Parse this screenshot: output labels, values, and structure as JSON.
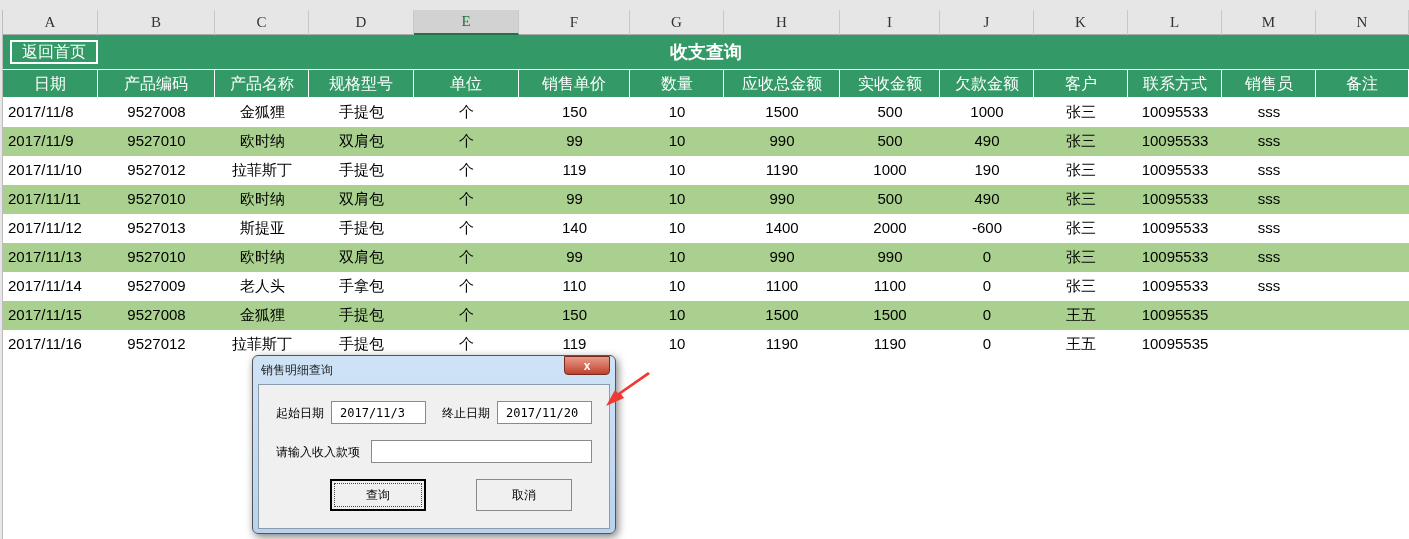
{
  "column_headers": [
    {
      "label": "A",
      "selected": false
    },
    {
      "label": "B",
      "selected": false
    },
    {
      "label": "C",
      "selected": false
    },
    {
      "label": "D",
      "selected": false
    },
    {
      "label": "E",
      "selected": true
    },
    {
      "label": "F",
      "selected": false
    },
    {
      "label": "G",
      "selected": false
    },
    {
      "label": "H",
      "selected": false
    },
    {
      "label": "I",
      "selected": false
    },
    {
      "label": "J",
      "selected": false
    },
    {
      "label": "K",
      "selected": false
    },
    {
      "label": "L",
      "selected": false
    },
    {
      "label": "M",
      "selected": false
    },
    {
      "label": "N",
      "selected": false
    }
  ],
  "home_button": "返回首页",
  "sheet_title": "收支查询",
  "table": {
    "columns": [
      "日期",
      "产品编码",
      "产品名称",
      "规格型号",
      "单位",
      "销售单价",
      "数量",
      "应收总金额",
      "实收金额",
      "欠款金额",
      "客户",
      "联系方式",
      "销售员",
      "备注"
    ],
    "rows": [
      {
        "cells": [
          "2017/11/8",
          "9527008",
          "金狐狸",
          "手提包",
          "个",
          "150",
          "10",
          "1500",
          "500",
          "1000",
          "张三",
          "10095533",
          "sss"
        ]
      },
      {
        "cells": [
          "2017/11/9",
          "9527010",
          "欧时纳",
          "双肩包",
          "个",
          "99",
          "10",
          "990",
          "500",
          "490",
          "张三",
          "10095533",
          "sss"
        ]
      },
      {
        "cells": [
          "2017/11/10",
          "9527012",
          "拉菲斯丁",
          "手提包",
          "个",
          "119",
          "10",
          "1190",
          "1000",
          "190",
          "张三",
          "10095533",
          "sss"
        ]
      },
      {
        "cells": [
          "2017/11/11",
          "9527010",
          "欧时纳",
          "双肩包",
          "个",
          "99",
          "10",
          "990",
          "500",
          "490",
          "张三",
          "10095533",
          "sss"
        ]
      },
      {
        "cells": [
          "2017/11/12",
          "9527013",
          "斯提亚",
          "手提包",
          "个",
          "140",
          "10",
          "1400",
          "2000",
          "-600",
          "张三",
          "10095533",
          "sss"
        ]
      },
      {
        "cells": [
          "2017/11/13",
          "9527010",
          "欧时纳",
          "双肩包",
          "个",
          "99",
          "10",
          "990",
          "990",
          "0",
          "张三",
          "10095533",
          "sss"
        ]
      },
      {
        "cells": [
          "2017/11/14",
          "9527009",
          "老人头",
          "手拿包",
          "个",
          "110",
          "10",
          "1100",
          "1100",
          "0",
          "张三",
          "10095533",
          "sss"
        ]
      },
      {
        "cells": [
          "2017/11/15",
          "9527008",
          "金狐狸",
          "手提包",
          "个",
          "150",
          "10",
          "1500",
          "1500",
          "0",
          "王五",
          "10095535"
        ]
      },
      {
        "cells": [
          "2017/11/16",
          "9527012",
          "拉菲斯丁",
          "手提包",
          "个",
          "119",
          "10",
          "1190",
          "1190",
          "0",
          "王五",
          "10095535"
        ]
      }
    ]
  },
  "dialog": {
    "title": "销售明细查询",
    "close": "x",
    "start_label": "起始日期",
    "start_value": "2017/11/3",
    "end_label": "终止日期",
    "end_value": "2017/11/20",
    "income_label": "请输入收入款项",
    "buttons": [
      {
        "label": "查询",
        "default": true
      },
      {
        "label": "取消",
        "default": false
      }
    ]
  }
}
